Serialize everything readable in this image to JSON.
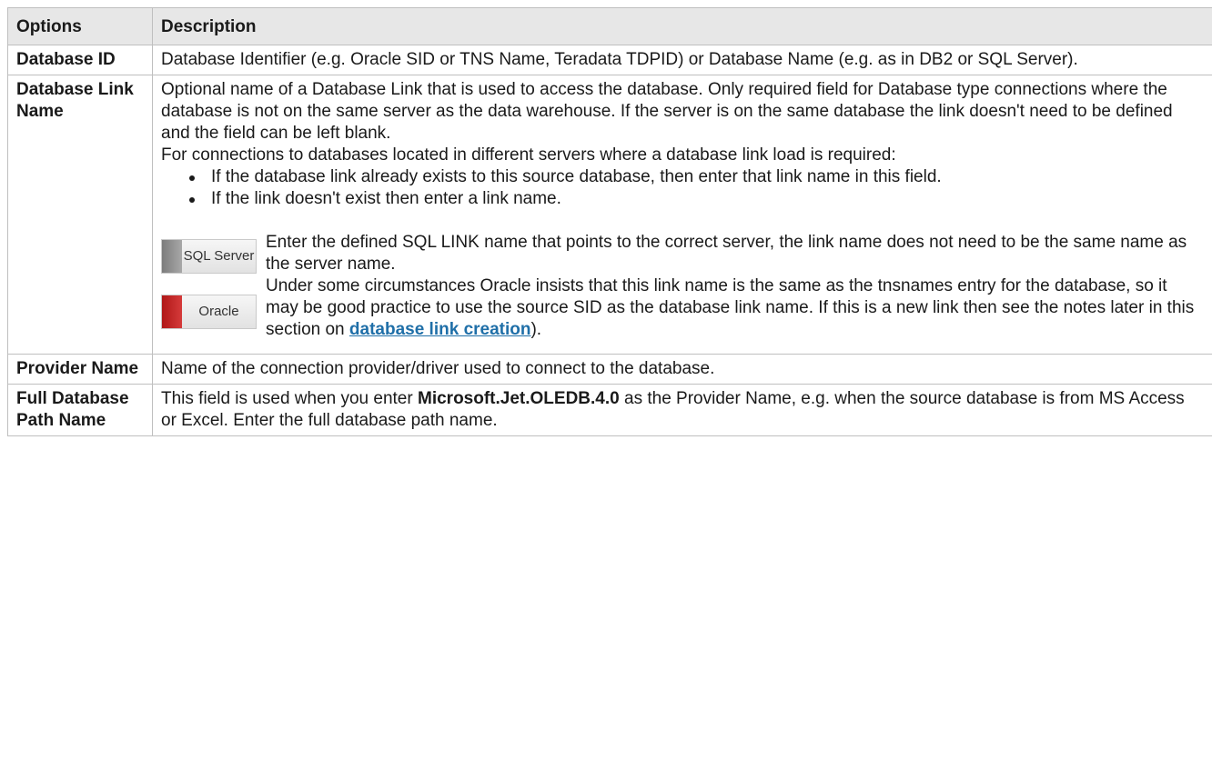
{
  "table": {
    "headers": [
      "Options",
      "Description"
    ],
    "rows": [
      {
        "option": "Database ID",
        "description": "Database Identifier (e.g. Oracle SID or TNS Name, Teradata TDPID) or Database Name (e.g. as in DB2 or SQL Server)."
      },
      {
        "option": "Database Link Name",
        "paragraph1": "Optional name of a Database Link that is used to access the database. Only required field for Database type connections where the database is not on the same server as the data warehouse. If the server is on the same database the link doesn't need to be defined and the field can be left blank.",
        "paragraph2": "For connections to databases located in different servers where a database link load is required:",
        "bullets": [
          "If the database link already exists to this source database, then enter that link name in this field.",
          "If the link doesn't exist then enter a link name."
        ],
        "sqlserver": {
          "badge_label": "SQL Server",
          "text": " Enter the defined SQL LINK name that points to the correct server, the link name does not need to be the same name as the server name."
        },
        "oracle": {
          "badge_label": "Oracle",
          "text": " Under some circumstances Oracle insists that this link name is the same as the tnsnames entry for the database, so it may be good practice to use the source SID as the database link name. If this is a new link then see the notes later in this section on ",
          "link_text": "database link creation",
          "text_after": ")."
        }
      },
      {
        "option": "Provider Name",
        "description": "Name of the connection provider/driver used to connect to the database."
      },
      {
        "option": "Full Database Path Name",
        "description_before": "This field is used when you enter ",
        "description_bold": "Microsoft.Jet.OLEDB.4.0",
        "description_after": " as the Provider Name, e.g. when the source database is from MS Access or Excel. Enter the full database path name."
      }
    ]
  },
  "colors": {
    "header_bg": "#e7e7e7",
    "border": "#bfbfbf",
    "link": "#1f6fa8",
    "oracle_red": "#c62828"
  }
}
